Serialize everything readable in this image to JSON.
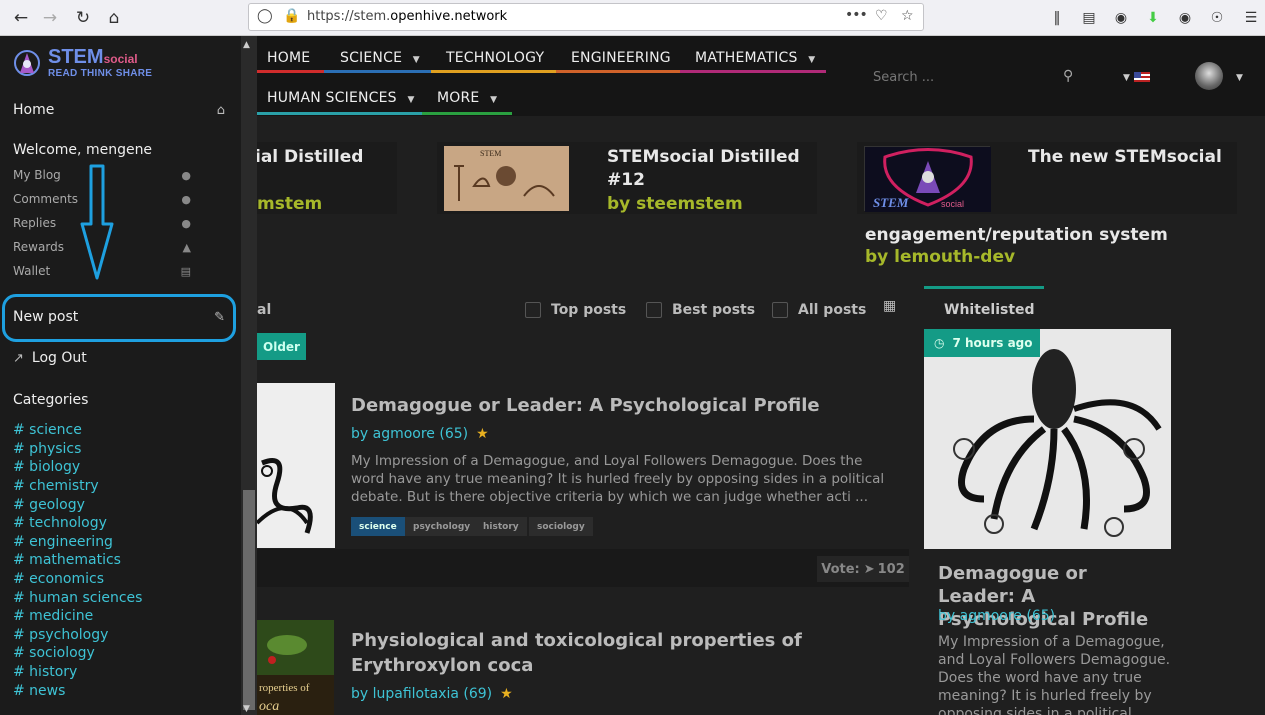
{
  "browser": {
    "url_prefix": "https://stem.",
    "url_domain": "openhive.network",
    "back_icon": "back-arrow-icon",
    "forward_icon": "forward-arrow-icon",
    "reload_icon": "reload-icon",
    "home_icon": "home-icon",
    "more_dots": "•••"
  },
  "logo": {
    "name": "STEM",
    "suffix": "social",
    "tagline": "READ THINK SHARE"
  },
  "sidebar": {
    "home": "Home",
    "welcome": "Welcome, mengene",
    "items": [
      {
        "label": "My Blog",
        "icon": "user-icon"
      },
      {
        "label": "Comments",
        "icon": "comment-icon"
      },
      {
        "label": "Replies",
        "icon": "comments-icon"
      },
      {
        "label": "Rewards",
        "icon": "trophy-icon"
      },
      {
        "label": "Wallet",
        "icon": "wallet-icon"
      }
    ],
    "new_post": "New post",
    "logout": "Log Out",
    "categories_title": "Categories",
    "categories": [
      "# science",
      "# physics",
      "# biology",
      "# chemistry",
      "# geology",
      "# technology",
      "# engineering",
      "# mathematics",
      "# economics",
      "# human sciences",
      "# medicine",
      "# psychology",
      "# sociology",
      "# history",
      "# news"
    ]
  },
  "topnav": {
    "items": [
      "HOME",
      "SCIENCE",
      "TECHNOLOGY",
      "ENGINEERING",
      "MATHEMATICS",
      "HUMAN SCIENCES",
      "MORE"
    ],
    "search_placeholder": "Search ..."
  },
  "featured": [
    {
      "title": "ial Distilled",
      "author": "mstem"
    },
    {
      "title_line1": "STEMsocial Distilled",
      "title_line2": "#12",
      "author": "by steemstem"
    },
    {
      "title": "The new STEMsocial",
      "title_line2": "engagement/reputation system",
      "author": "by lemouth-dev"
    }
  ],
  "filters": {
    "left_label": "al",
    "top_posts": "Top posts",
    "best_posts": "Best posts",
    "all_posts": "All posts",
    "older": "Older"
  },
  "posts": [
    {
      "title": "Demagogue or Leader: A Psychological Profile",
      "author": "by agmoore (65)",
      "excerpt": "My Impression of a Demagogue, and Loyal Followers Demagogue. Does the word have any true meaning? It is hurled freely by opposing sides in a political debate. But is there objective criteria by which we can judge whether acti ...",
      "tags": [
        "science",
        "psychology",
        "history",
        "sociology"
      ],
      "vote_label": "Vote:",
      "vote_count": "102"
    },
    {
      "title": "Physiological and toxicological properties of Erythroxylon coca",
      "author": "by lupafilotaxia (69)",
      "thumb_text_1": "roperties of",
      "thumb_text_2": "oca"
    }
  ],
  "whitelist": {
    "tab": "Whitelisted",
    "badge": "7 hours ago",
    "title": "Demagogue or Leader: A Psychological Profile",
    "author": "by agmoore (65)",
    "excerpt": "My Impression of a Demagogue, and Loyal Followers Demagogue. Does the word have any true meaning? It is hurled freely by opposing sides in a political debate. But is there objective"
  },
  "colors": {
    "accent_teal": "#149b86",
    "link_cyan": "#3ec3d5",
    "author_olive": "#a6b82a",
    "highlight_blue": "#1ea0e0",
    "nav_home": "#d02c2c",
    "nav_science": "#2b6fb5",
    "nav_technology": "#e0a020",
    "nav_engineering": "#d0622a",
    "nav_mathematics": "#b02a78",
    "nav_human": "#2aa0a8",
    "nav_more": "#2aa040"
  }
}
